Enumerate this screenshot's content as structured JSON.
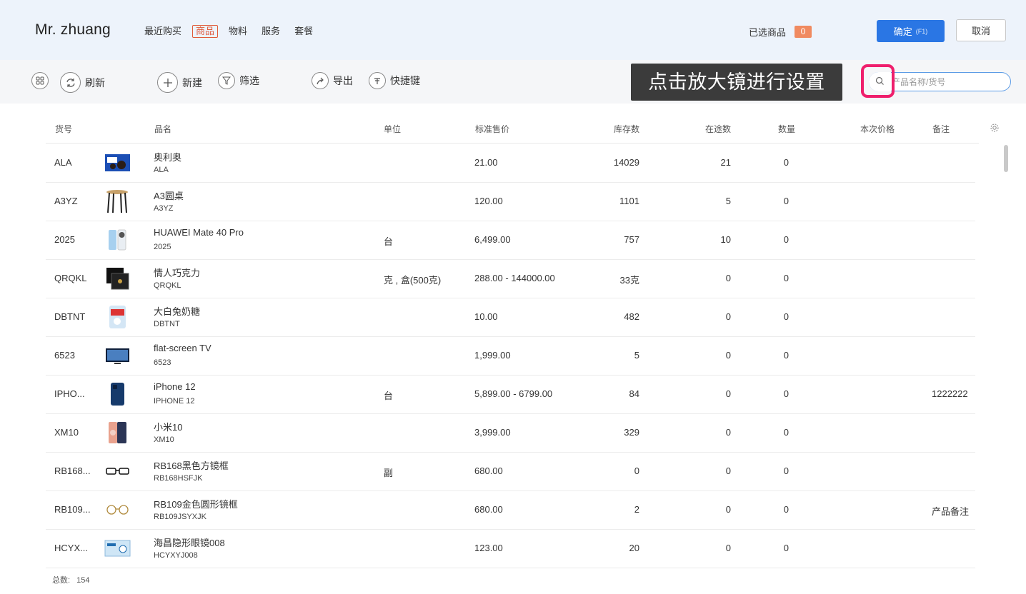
{
  "header": {
    "brand": "Mr. zhuang",
    "nav": [
      "最近购买",
      "商品",
      "物料",
      "服务",
      "套餐"
    ],
    "nav_active": 1,
    "selected_label": "已选商品",
    "selected_count": "0",
    "confirm_label": "确定",
    "confirm_hotkey": "(F1)",
    "cancel_label": "取消"
  },
  "toolbar": {
    "refresh": "刷新",
    "new": "新建",
    "filter": "筛选",
    "export": "导出",
    "shortcut": "快捷键"
  },
  "tooltip": "点击放大镜进行设置",
  "search": {
    "placeholder": "产品名称/货号"
  },
  "table": {
    "headers": {
      "code": "货号",
      "name": "品名",
      "unit": "单位",
      "price": "标准售价",
      "stock": "库存数",
      "transit": "在途数",
      "qty": "数量",
      "current_price": "本次价格",
      "remark": "备注"
    },
    "rows": [
      {
        "code": "ALA",
        "name": "奥利奥",
        "sub": "ALA",
        "unit": "",
        "price": "21.00",
        "stock": "14029",
        "transit": "21",
        "qty": "0",
        "remark": "",
        "thumb": "oreo"
      },
      {
        "code": "A3YZ",
        "name": "A3圆桌",
        "sub": "A3YZ",
        "unit": "",
        "price": "120.00",
        "stock": "1101",
        "transit": "5",
        "qty": "0",
        "remark": "",
        "thumb": "stool"
      },
      {
        "code": "2025",
        "name": "HUAWEI Mate 40 Pro",
        "sub": "2025",
        "unit": "台",
        "price": "6,499.00",
        "stock": "757",
        "transit": "10",
        "qty": "0",
        "remark": "",
        "thumb": "phone-white"
      },
      {
        "code": "QRQKL",
        "name": "情人巧克力",
        "sub": "QRQKL",
        "unit": "克 , 盒(500克)",
        "price": "288.00 - 144000.00",
        "stock": "33克",
        "transit": "0",
        "qty": "0",
        "remark": "",
        "thumb": "chocolate"
      },
      {
        "code": "DBTNT",
        "name": "大白兔奶糖",
        "sub": "DBTNT",
        "unit": "",
        "price": "10.00",
        "stock": "482",
        "transit": "0",
        "qty": "0",
        "remark": "",
        "thumb": "candy"
      },
      {
        "code": "6523",
        "name": "flat-screen TV",
        "sub": "6523",
        "unit": "",
        "price": "1,999.00",
        "stock": "5",
        "transit": "0",
        "qty": "0",
        "remark": "",
        "thumb": "tv"
      },
      {
        "code": "IPHO...",
        "name": "iPhone 12",
        "sub": "IPHONE 12",
        "unit": "台",
        "price": "5,899.00 - 6799.00",
        "stock": "84",
        "transit": "0",
        "qty": "0",
        "remark": "1222222",
        "thumb": "iphone"
      },
      {
        "code": "XM10",
        "name": "小米10",
        "sub": "XM10",
        "unit": "",
        "price": "3,999.00",
        "stock": "329",
        "transit": "0",
        "qty": "0",
        "remark": "",
        "thumb": "xiaomi"
      },
      {
        "code": "RB168...",
        "name": "RB168黑色方镜框",
        "sub": "RB168HSFJK",
        "unit": "副",
        "price": "680.00",
        "stock": "0",
        "transit": "0",
        "qty": "0",
        "remark": "",
        "thumb": "glasses-black"
      },
      {
        "code": "RB109...",
        "name": "RB109金色圆形镜框",
        "sub": "RB109JSYXJK",
        "unit": "",
        "price": "680.00",
        "stock": "2",
        "transit": "0",
        "qty": "0",
        "remark": "产品备注",
        "thumb": "glasses-gold"
      },
      {
        "code": "HCYX...",
        "name": "海昌隐形眼镜008",
        "sub": "HCYXYJ008",
        "unit": "",
        "price": "123.00",
        "stock": "20",
        "transit": "0",
        "qty": "0",
        "remark": "",
        "thumb": "lens"
      }
    ]
  },
  "footer": {
    "total_label": "总数:",
    "total_value": "154"
  }
}
